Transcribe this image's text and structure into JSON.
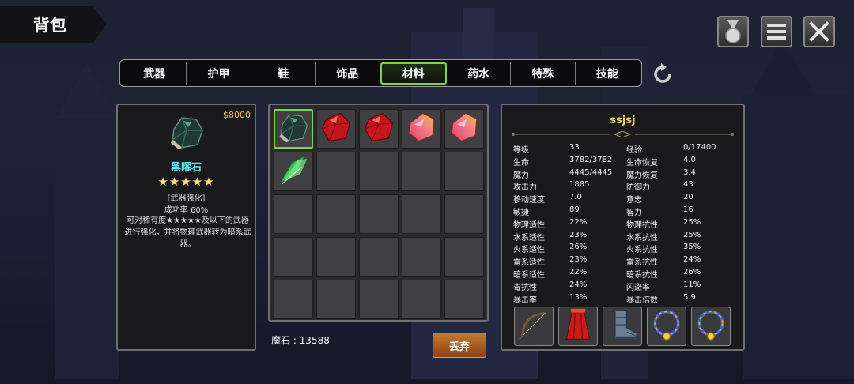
{
  "header": {
    "title": "背包"
  },
  "tabs": [
    {
      "label": "武器",
      "active": false
    },
    {
      "label": "护甲",
      "active": false
    },
    {
      "label": "鞋",
      "active": false
    },
    {
      "label": "饰品",
      "active": false
    },
    {
      "label": "材料",
      "active": true
    },
    {
      "label": "药水",
      "active": false
    },
    {
      "label": "特殊",
      "active": false
    },
    {
      "label": "技能",
      "active": false
    }
  ],
  "item_detail": {
    "price": "$8000",
    "icon": "obsidian-gem-icon",
    "name": "黑曜石",
    "stars": "★★★★★",
    "tag": "[武器强化]",
    "success_rate": "成功率 60%",
    "description": "可对稀有度★★★★★及以下的武器进行强化，并将物理武器转为暗系武器。"
  },
  "inventory": {
    "items": [
      {
        "icon": "obsidian-gem-icon",
        "selected": true
      },
      {
        "icon": "red-ruby-icon",
        "selected": false
      },
      {
        "icon": "red-ruby-icon",
        "selected": false
      },
      {
        "icon": "pink-gold-crystal-icon",
        "selected": false
      },
      {
        "icon": "pink-gold-crystal-icon",
        "selected": false
      },
      {
        "icon": "green-crystal-shard-icon",
        "selected": false
      }
    ],
    "empty_slots": 19,
    "mana_stone": "魔石 : 13588",
    "discard_label": "丢弃"
  },
  "stats": {
    "player_name": "ssjsj",
    "rows": [
      [
        "等级",
        "33",
        "经验",
        "0/17400"
      ],
      [
        "生命",
        "3782/3782",
        "生命恢复",
        "4.0"
      ],
      [
        "魔力",
        "4445/4445",
        "魔力恢复",
        "3.4"
      ],
      [
        "攻击力",
        "1885",
        "防御力",
        "43"
      ],
      [
        "移动速度",
        "7.0",
        "意志",
        "20"
      ],
      [
        "敏捷",
        "89",
        "智力",
        "16"
      ],
      [
        "物理适性",
        "22%",
        "物理抗性",
        "25%"
      ],
      [
        "水系适性",
        "23%",
        "水系抗性",
        "25%"
      ],
      [
        "火系适性",
        "26%",
        "火系抗性",
        "35%"
      ],
      [
        "雷系适性",
        "23%",
        "雷系抗性",
        "24%"
      ],
      [
        "暗系适性",
        "22%",
        "暗系抗性",
        "26%"
      ],
      [
        "毒抗性",
        "24%",
        "闪避率",
        "11%"
      ],
      [
        "暴击率",
        "13%",
        "暴击倍数",
        "5.9"
      ]
    ],
    "equipment": [
      {
        "icon": "bow-icon"
      },
      {
        "icon": "red-cape-icon"
      },
      {
        "icon": "armored-boot-icon"
      },
      {
        "icon": "gold-ring-icon"
      },
      {
        "icon": "gold-ring-icon"
      }
    ]
  },
  "colors": {
    "active_tab_border": "#7fd14a",
    "price": "#f0c23a",
    "item_name": "#5fe3ff",
    "player_name": "#f2d06a",
    "discard_button": "#b5622a"
  }
}
